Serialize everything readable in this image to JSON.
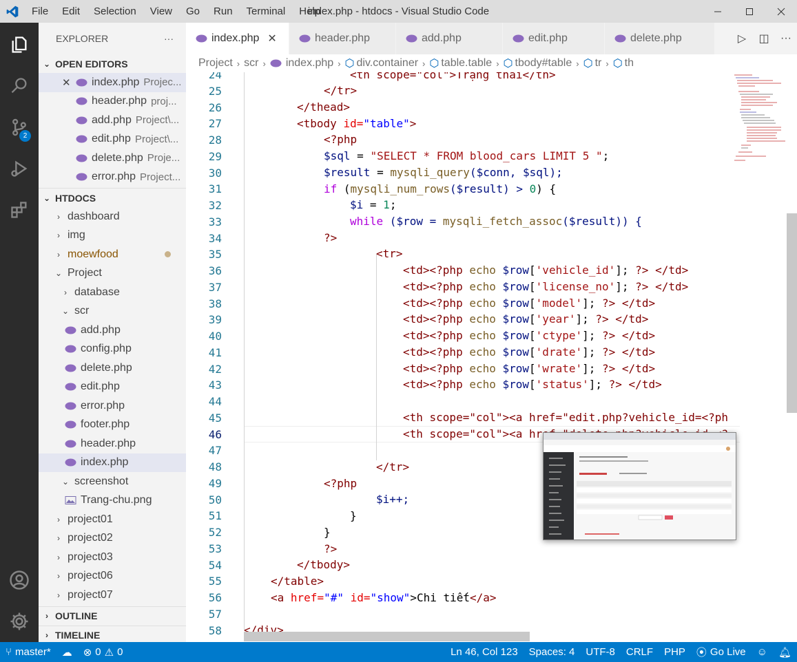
{
  "window": {
    "title": "index.php - htdocs - Visual Studio Code",
    "menu": [
      "File",
      "Edit",
      "Selection",
      "View",
      "Go",
      "Run",
      "Terminal",
      "Help"
    ]
  },
  "activity": {
    "scm_badge": "2"
  },
  "sidebar": {
    "title": "EXPLORER",
    "more": "···",
    "open_editors_label": "OPEN EDITORS",
    "open_editors": [
      {
        "name": "index.php",
        "path": "Projec..."
      },
      {
        "name": "header.php",
        "path": "proj..."
      },
      {
        "name": "add.php",
        "path": "Project\\..."
      },
      {
        "name": "edit.php",
        "path": "Project\\..."
      },
      {
        "name": "delete.php",
        "path": "Proje..."
      },
      {
        "name": "error.php",
        "path": "Project..."
      }
    ],
    "htdocs_label": "HTDOCS",
    "tree": {
      "dashboard": "dashboard",
      "img": "img",
      "moewfood": "moewfood",
      "project": "Project",
      "database": "database",
      "scr": "scr",
      "scr_files": [
        "add.php",
        "config.php",
        "delete.php",
        "edit.php",
        "error.php",
        "footer.php",
        "header.php",
        "index.php"
      ],
      "screenshot": "screenshot",
      "screenshot_file": "Trang-chu.png",
      "others": [
        "project01",
        "project02",
        "project03",
        "project06",
        "project07"
      ]
    },
    "outline_label": "OUTLINE",
    "timeline_label": "TIMELINE"
  },
  "tabs": [
    "index.php",
    "header.php",
    "add.php",
    "edit.php",
    "delete.php"
  ],
  "breadcrumb": [
    "Project",
    "scr",
    "index.php",
    "div.container",
    "table.table",
    "tbody#table",
    "tr",
    "th"
  ],
  "editor": {
    "line_numbers": [
      "24",
      "25",
      "26",
      "27",
      "28",
      "29",
      "30",
      "31",
      "32",
      "33",
      "34",
      "35",
      "36",
      "37",
      "38",
      "39",
      "40",
      "41",
      "42",
      "43",
      "44",
      "45",
      "46",
      "47",
      "48",
      "49",
      "50",
      "51",
      "52",
      "53",
      "54",
      "55",
      "56",
      "57",
      "58"
    ],
    "current_line": "46",
    "line_24": "<th scope=\"col\">Trạng thái</th>",
    "line_25": "</tr>",
    "line_26": "</thead>",
    "line_27_tag": "<tbody ",
    "line_27_attr": "id=",
    "line_27_val": "\"table\"",
    "line_27_end": ">",
    "line_28": "<?php",
    "line_29_var": "$sql",
    "line_29_eq": " = ",
    "line_29_str": "\"SELECT * FROM blood_cars LIMIT 5 \"",
    "line_29_end": ";",
    "line_30_var": "$result",
    "line_30_eq": " = ",
    "line_30_fn": "mysqli_query",
    "line_30_args": "($conn, $sql);",
    "line_31_kw": "if",
    "line_31_rest_a": " (",
    "line_31_fn": "mysqli_num_rows",
    "line_31_rest_b": "($result) > ",
    "line_31_num": "0",
    "line_31_rest_c": ") {",
    "line_32_var": "$i",
    "line_32_eq": " = ",
    "line_32_num": "1",
    "line_32_end": ";",
    "line_33_kw": "while",
    "line_33_a": " ($row = ",
    "line_33_fn": "mysqli_fetch_assoc",
    "line_33_b": "($result)) {",
    "line_34": "?>",
    "line_35": "<tr>",
    "td_lines": [
      {
        "key": "'vehicle_id'"
      },
      {
        "key": "'license_no'"
      },
      {
        "key": "'model'"
      },
      {
        "key": "'year'"
      },
      {
        "key": "'ctype'"
      },
      {
        "key": "'drate'"
      },
      {
        "key": "'wrate'"
      },
      {
        "key": "'status'"
      }
    ],
    "td_open": "<td>",
    "php_open": "<?php ",
    "echo": "echo ",
    "row_var": "$row",
    "td_tail": "]; ",
    "php_close": "?>",
    "td_close": " </td>",
    "line_45": "<th scope=\"col\"><a href=\"edit.php?vehicle_id=<?ph",
    "line_46": "<th scope=\"col\"><a href=\"delete.php?vehicle_id=<?",
    "line_48": "</tr>",
    "line_49": "<?php",
    "line_50": "$i++;",
    "line_51": "}",
    "line_52": "}",
    "line_53": "?>",
    "line_54": "</tbody>",
    "line_55": "</table>",
    "line_56_a": "<a ",
    "line_56_href": "href=",
    "line_56_hv": "\"#\"",
    "line_56_id": " id=",
    "line_56_iv": "\"show\"",
    "line_56_text": ">Chi tiết",
    "line_56_end": "</a>",
    "line_58": "</div>"
  },
  "statusbar": {
    "branch": "master*",
    "errors": "0",
    "warnings": "0",
    "position": "Ln 46, Col 123",
    "spaces": "Spaces: 4",
    "encoding": "UTF-8",
    "eol": "CRLF",
    "language": "PHP",
    "golive": "Go Live"
  },
  "colors": {
    "statusbar": "#007acc",
    "activitybar": "#2c2c2c",
    "sidebar": "#f3f3f3",
    "titlebar": "#dddddd"
  }
}
